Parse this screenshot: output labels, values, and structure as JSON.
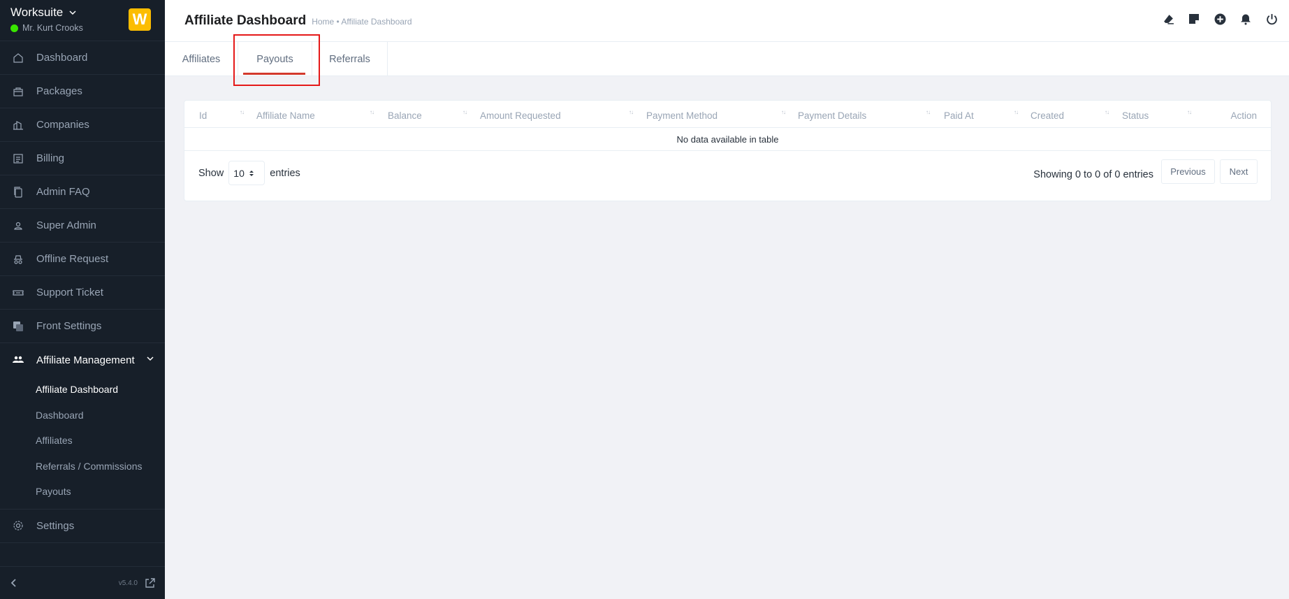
{
  "sidebar": {
    "brand": "Worksuite",
    "user": "Mr. Kurt Crooks",
    "logo_letter": "W",
    "items": [
      {
        "label": "Dashboard"
      },
      {
        "label": "Packages"
      },
      {
        "label": "Companies"
      },
      {
        "label": "Billing"
      },
      {
        "label": "Admin FAQ"
      },
      {
        "label": "Super Admin"
      },
      {
        "label": "Offline Request"
      },
      {
        "label": "Support Ticket"
      },
      {
        "label": "Front Settings"
      },
      {
        "label": "Affiliate Management"
      }
    ],
    "sub_items": [
      {
        "label": "Affiliate Dashboard"
      },
      {
        "label": "Dashboard"
      },
      {
        "label": "Affiliates"
      },
      {
        "label": "Referrals / Commissions"
      },
      {
        "label": "Payouts"
      }
    ],
    "settings": "Settings",
    "version": "v5.4.0"
  },
  "header": {
    "title": "Affiliate Dashboard",
    "breadcrumb": "Home • Affiliate Dashboard"
  },
  "tabs": [
    {
      "label": "Affiliates"
    },
    {
      "label": "Payouts"
    },
    {
      "label": "Referrals"
    }
  ],
  "table": {
    "columns": [
      "Id",
      "Affiliate Name",
      "Balance",
      "Amount Requested",
      "Payment Method",
      "Payment Details",
      "Paid At",
      "Created",
      "Status",
      "Action"
    ],
    "empty_message": "No data available in table",
    "show_label": "Show",
    "entries_label": "entries",
    "page_size": "10",
    "info": "Showing 0 to 0 of 0 entries",
    "previous": "Previous",
    "next": "Next"
  },
  "colors": {
    "sidebar_bg": "#171f29",
    "accent": "#d33a2d",
    "status_online": "#39e500",
    "logo_bg": "#fcbd01"
  }
}
